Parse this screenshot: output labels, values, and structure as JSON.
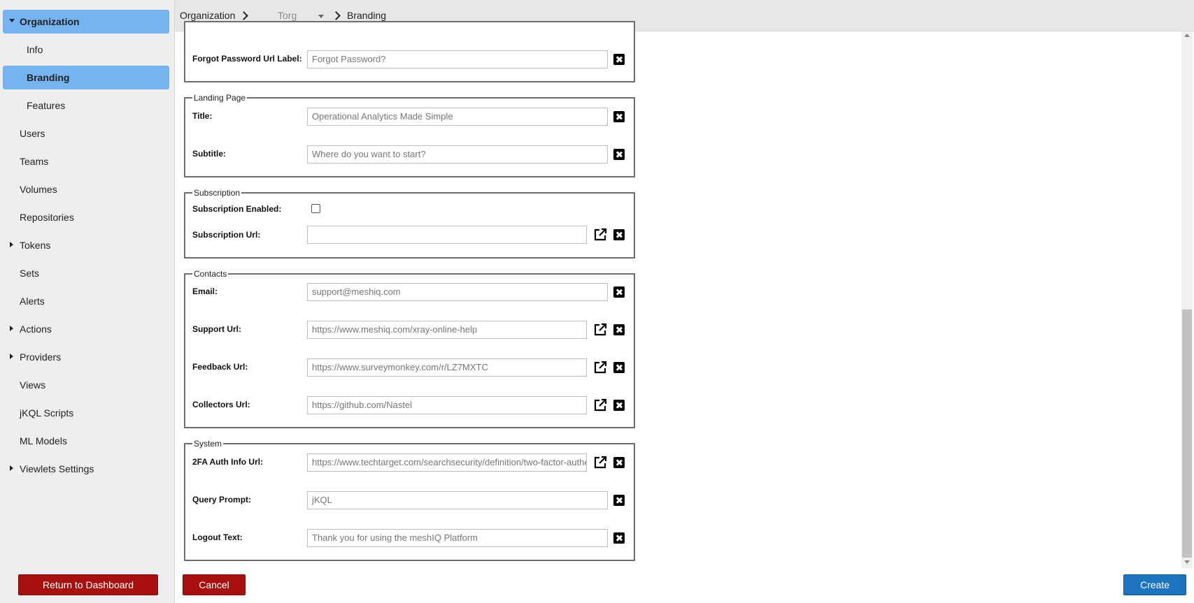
{
  "sidebar": {
    "items": [
      {
        "label": "Organization",
        "caret": "down"
      },
      {
        "label": "Info"
      },
      {
        "label": "Branding"
      },
      {
        "label": "Features"
      },
      {
        "label": "Users"
      },
      {
        "label": "Teams"
      },
      {
        "label": "Volumes"
      },
      {
        "label": "Repositories"
      },
      {
        "label": "Tokens",
        "caret": "right"
      },
      {
        "label": "Sets"
      },
      {
        "label": "Alerts"
      },
      {
        "label": "Actions",
        "caret": "right"
      },
      {
        "label": "Providers",
        "caret": "right"
      },
      {
        "label": "Views"
      },
      {
        "label": "jKQL Scripts"
      },
      {
        "label": "ML Models"
      },
      {
        "label": "Viewlets Settings",
        "caret": "right"
      }
    ],
    "return_label": "Return to Dashboard"
  },
  "breadcrumb": {
    "organization": "Organization",
    "org_name": "Torg",
    "current": "Branding"
  },
  "login": {
    "forgot_label": "Forgot Password Url Label:",
    "forgot_value": "Forgot Password?"
  },
  "landing": {
    "legend": "Landing Page",
    "title_label": "Title:",
    "title_value": "Operational Analytics Made Simple",
    "subtitle_label": "Subtitle:",
    "subtitle_value": "Where do you want to start?"
  },
  "subscription": {
    "legend": "Subscription",
    "enabled_label": "Subscription Enabled:",
    "url_label": "Subscription Url:",
    "url_value": ""
  },
  "contacts": {
    "legend": "Contacts",
    "email_label": "Email:",
    "email_value": "support@meshiq.com",
    "support_label": "Support Url:",
    "support_value": "https://www.meshiq.com/xray-online-help",
    "feedback_label": "Feedback Url:",
    "feedback_value": "https://www.surveymonkey.com/r/LZ7MXTC",
    "collectors_label": "Collectors Url:",
    "collectors_value": "https://github.com/Nastel"
  },
  "system": {
    "legend": "System",
    "twofa_label": "2FA Auth Info Url:",
    "twofa_value": "https://www.techtarget.com/searchsecurity/definition/two-factor-authentication",
    "query_label": "Query Prompt:",
    "query_value": "jKQL",
    "logout_label": "Logout Text:",
    "logout_value": "Thank you for using the meshIQ Platform"
  },
  "actions": {
    "cancel_label": "Cancel",
    "create_label": "Create"
  }
}
